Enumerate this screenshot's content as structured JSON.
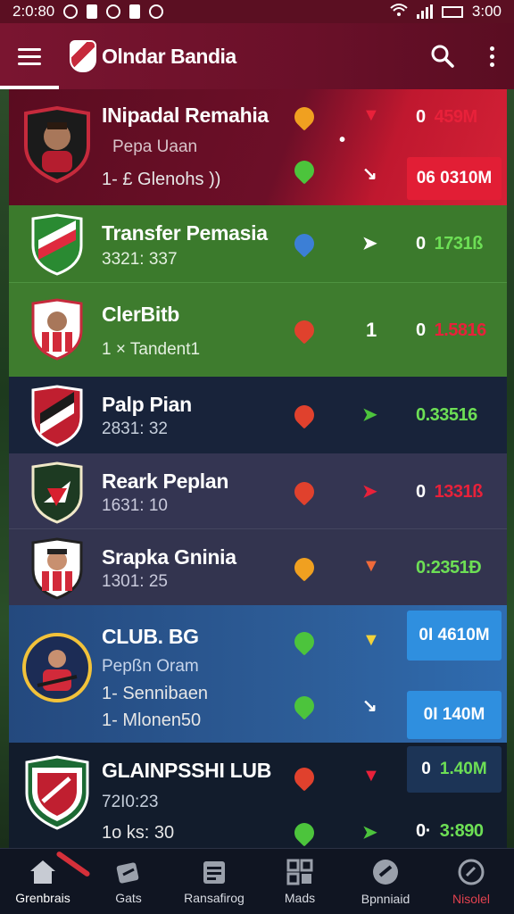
{
  "status_bar": {
    "time_left": "2:0:80",
    "time_right": "3:00"
  },
  "app": {
    "title": "Olndar Bandia"
  },
  "colors": {
    "primary": "#7a1530",
    "accent_red": "#e02a3e",
    "accent_green": "#3fb54a",
    "accent_blue": "#2f86d6"
  },
  "rows": [
    {
      "name": "INipadal Remahia",
      "sub": "Pepa Uaan",
      "sub2": "1- £ Glenohs ))",
      "value": "459M",
      "box_value": "06 0310M",
      "icon_top": "shield-orange-icon",
      "icon_bottom": "shield-green-icon",
      "mid_mark": "•",
      "theme": "red"
    },
    {
      "name": "Transfer Pemasia",
      "sub": "3321: 337",
      "value": "1731ß",
      "icon": "shield-blue-icon",
      "theme": "green"
    },
    {
      "name": "ClerBitb",
      "sub": "1 × Tandent1",
      "value": "1.5816",
      "mid_mark": "1",
      "icon": "shield-red-icon",
      "theme": "green"
    },
    {
      "name": "Palp Pian",
      "sub": "2831: 32",
      "value": "0.33516",
      "icon": "shield-red-icon",
      "theme": "navy"
    },
    {
      "name": "Reark Peplan",
      "sub": "1631: 10",
      "value": "1331ß",
      "icon": "shield-red-icon",
      "theme": "purple"
    },
    {
      "name": "Srapka Gninia",
      "sub": "1301: 25",
      "value": "0:2351Ð",
      "icon": "shield-orange-icon",
      "theme": "purple"
    },
    {
      "name": "CLUB. BG",
      "sub": "Pepßn Oram",
      "sub2": "1- Sennibaen",
      "sub3": "1- Mlonen50",
      "box_value": "0I 4610M",
      "box_value2": "0I 140M",
      "icon_top": "shield-green-icon",
      "icon_bottom": "shield-green-icon",
      "theme": "blue"
    },
    {
      "name": "GLAINPSSHI LUB",
      "sub": "72I0:23",
      "sub2": "1o ks: 30",
      "box_value": "1.40M",
      "value": "3:890",
      "icon_top": "shield-red-icon",
      "icon_bottom": "shield-green-icon",
      "theme": "dark"
    }
  ],
  "bottom_nav": [
    {
      "label": "Grenbrais",
      "icon": "home-icon"
    },
    {
      "label": "Gats",
      "icon": "cards-icon"
    },
    {
      "label": "Ransafirog",
      "icon": "clipboard-icon"
    },
    {
      "label": "Mads",
      "icon": "grid-icon"
    },
    {
      "label": "Bpnniaid",
      "icon": "ball-icon"
    },
    {
      "label": "Nisolel",
      "icon": "power-icon"
    }
  ]
}
